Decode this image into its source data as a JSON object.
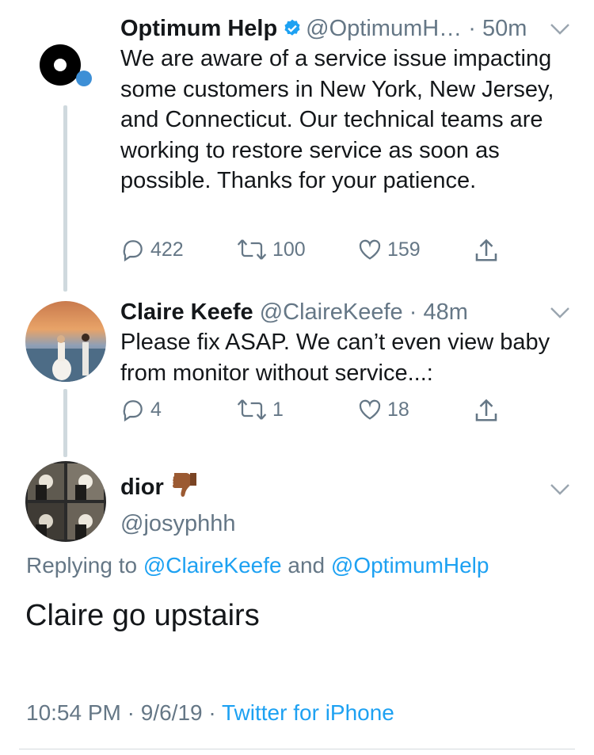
{
  "tweets": [
    {
      "name": "Optimum Help",
      "handle": "@OptimumH…",
      "sep": "·",
      "time": "50m",
      "text": "We are aware of a service issue impacting some customers in New York, New Jersey, and Connecticut. Our technical teams are working to restore service as soon as possible. Thanks for your patience.",
      "replies": "422",
      "retweets": "100",
      "likes": "159"
    },
    {
      "name": "Claire Keefe",
      "handle": "@ClaireKeefe",
      "sep": "·",
      "time": "48m",
      "text": "Please fix ASAP. We can’t even view baby from monitor without service...:",
      "replies": "4",
      "retweets": "1",
      "likes": "18"
    }
  ],
  "main": {
    "name": "dior",
    "handle": "@josyphhh",
    "replying_prefix": "Replying to",
    "replying_user1": "@ClaireKeefe",
    "replying_and": "and",
    "replying_user2": "@OptimumHelp",
    "text": "Claire go upstairs",
    "time": "10:54 PM",
    "sep": "·",
    "date": "9/6/19",
    "source": "Twitter for iPhone"
  },
  "colors": {
    "accent": "#1da1f2",
    "muted": "#657786",
    "text": "#14171a"
  },
  "icons": [
    "verified-badge-icon",
    "chevron-down-icon",
    "reply-icon",
    "retweet-icon",
    "like-icon",
    "share-icon",
    "thumbs-down-emoji"
  ]
}
